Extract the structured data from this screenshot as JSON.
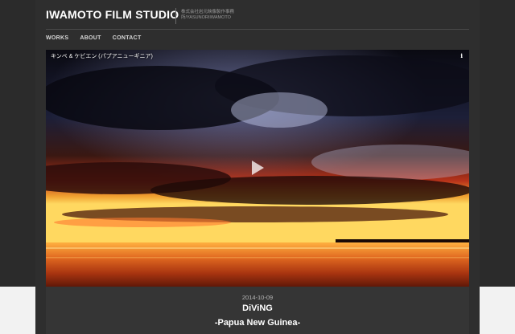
{
  "site": {
    "title": "IWAMOTO FILM STUDIO",
    "tagline_line1": "株式会社岩元映像製作事務",
    "tagline_line2": "所/YASUNORIIWAMOTO"
  },
  "nav": {
    "items": [
      {
        "label": "WORKS"
      },
      {
        "label": "ABOUT"
      },
      {
        "label": "CONTACT"
      }
    ]
  },
  "video": {
    "title": "キンベ & ケビエン (パプアニューギニア)",
    "info_icon": "info-icon",
    "play_icon": "play-icon"
  },
  "post": {
    "date": "2014-10-09",
    "title": "DiViNG",
    "subtitle": "-Papua New Guinea-"
  },
  "colors": {
    "page_background": "#2b2b2b",
    "container_background": "#2e2e2e",
    "bottom_band": "#f2f2f2",
    "text_primary": "#ffffff",
    "text_muted": "#9a9a9a"
  }
}
